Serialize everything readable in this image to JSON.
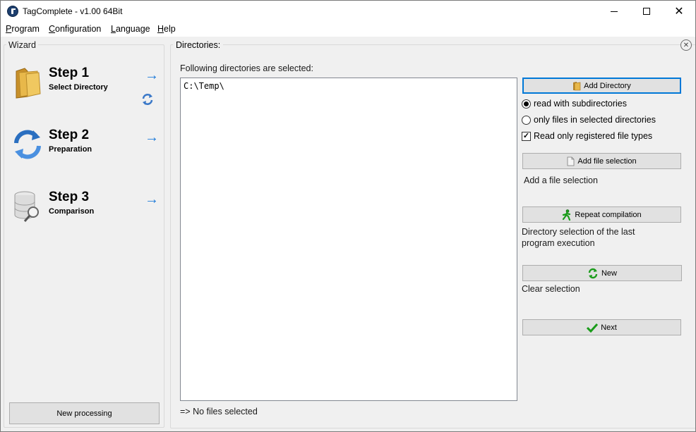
{
  "window": {
    "title": "TagComplete - v1.00 64Bit",
    "controls": {
      "minimize": "",
      "maximize": "",
      "close": "✕"
    }
  },
  "menu": {
    "items": [
      {
        "label": "Program",
        "accel": "P",
        "rest": "rogram"
      },
      {
        "label": "Configuration",
        "accel": "C",
        "rest": "onfiguration"
      },
      {
        "label": "Language",
        "accel": "L",
        "rest": "anguage"
      },
      {
        "label": "Help",
        "accel": "H",
        "rest": "elp"
      }
    ]
  },
  "wizard": {
    "title": "Wizard",
    "steps": [
      {
        "title": "Step 1",
        "subtitle": "Select Directory",
        "icon": "folder-icon",
        "arrow": "→"
      },
      {
        "title": "Step 2",
        "subtitle": "Preparation",
        "icon": "refresh-icon",
        "arrow": "→"
      },
      {
        "title": "Step 3",
        "subtitle": "Comparison",
        "icon": "database-search-icon",
        "arrow": "→"
      }
    ],
    "new_processing_label": "New processing"
  },
  "directories": {
    "title": "Directories:",
    "list_label": "Following directories are selected:",
    "entries": [
      "C:\\Temp\\"
    ],
    "status": "=> No files selected",
    "close_symbol": "✕"
  },
  "actions": {
    "add_directory_label": "Add Directory",
    "options": {
      "read_subdirs": "read with subdirectories",
      "only_selected": "only files in selected directories",
      "registered_only": "Read only registered file types",
      "selected": "read_subdirs",
      "registered_only_checked": true,
      "check_mark": "✓"
    },
    "add_file_selection_label": "Add file selection",
    "add_file_selection_desc": "Add a file selection",
    "repeat_compilation_label": "Repeat compilation",
    "repeat_compilation_desc": "Directory selection of the last program execution",
    "new_label": "New",
    "new_desc": "Clear selection",
    "next_label": "Next"
  },
  "colors": {
    "accent": "#0078d7",
    "arrow": "#1e7bd9",
    "panel_bg": "#f0f0f0",
    "green_check": "#1a9c1a",
    "folder": "#e8b84a"
  }
}
